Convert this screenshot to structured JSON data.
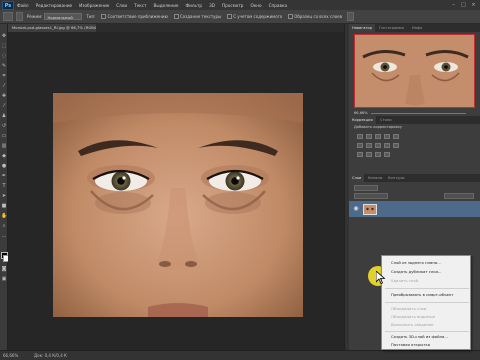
{
  "menubar": {
    "logo": "Ps",
    "items": [
      "Файл",
      "Редактирование",
      "Изображение",
      "Слои",
      "Текст",
      "Выделение",
      "Фильтр",
      "3D",
      "Просмотр",
      "Окно",
      "Справка"
    ],
    "window_buttons": [
      "–",
      "□",
      "×"
    ]
  },
  "options": {
    "mode_label": "Режим:",
    "mode_value": "Нормальный",
    "type_label": "Тип:",
    "type_1": "Соответствие приближению",
    "type_2": "Создание текстуры",
    "type_3": "С учетом содержимого",
    "sample_label": "Образец со всех слоев"
  },
  "document": {
    "tab_label": "Morsiot-psd-glasses1_RI.jpg @ 66,7% (RGB/8#) *"
  },
  "statusbar": {
    "zoom": "66,66%",
    "doc_size": "Док: 0,4 К/0,4 К"
  },
  "panels": {
    "navigator_tab": "Навигатор",
    "histogram_tab": "Гистограмма",
    "info_tab": "Инфо",
    "nav_zoom": "66,66%",
    "adjustments_tab": "Коррекция",
    "styles_tab": "Стили",
    "adjustments_title": "Добавить корректировку",
    "layers_tab": "Слои",
    "channels_tab": "Каналы",
    "paths_tab": "Контуры"
  },
  "context_menu": {
    "items": [
      {
        "label": "Слой из заднего плана...",
        "enabled": true
      },
      {
        "label": "Создать дубликат слоя...",
        "enabled": true
      },
      {
        "label": "Удалить слой",
        "enabled": false
      },
      {
        "label": "Преобразовать в смарт-объект",
        "enabled": true
      },
      {
        "label": "Объединить слои",
        "enabled": false
      },
      {
        "label": "Объединить видимые",
        "enabled": false
      },
      {
        "label": "Выполнить сведение",
        "enabled": false
      },
      {
        "label": "Создать 3D-слой из файла...",
        "enabled": true
      },
      {
        "label": "Почтовая открытка",
        "enabled": true
      }
    ]
  },
  "colors": {
    "app_bg": "#262626",
    "panel_bg": "#3d3d3d",
    "highlight": "#ffeb28",
    "selected_layer": "#4d6a8a"
  }
}
